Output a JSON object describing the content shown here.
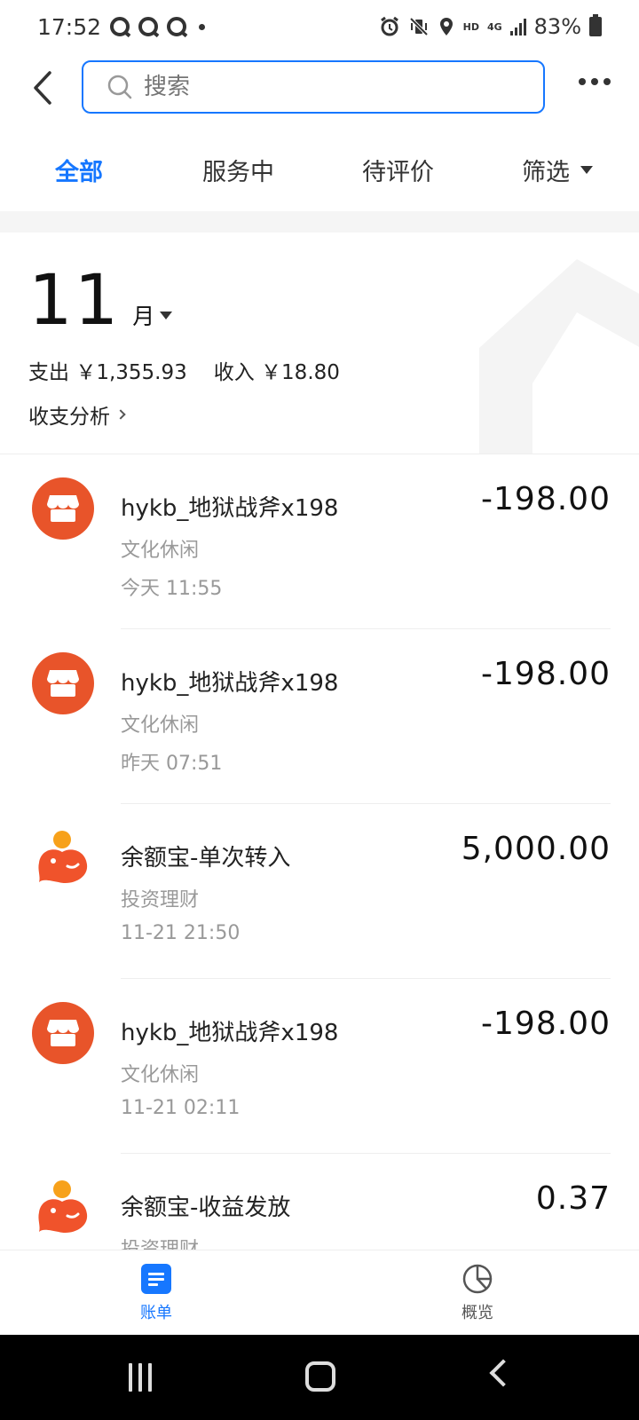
{
  "status_bar": {
    "time": "17:52",
    "battery": "83%",
    "hd_label": "HD",
    "network_label": "4G"
  },
  "header": {
    "search_placeholder": "搜索"
  },
  "tabs": [
    {
      "label": "全部",
      "active": true
    },
    {
      "label": "服务中",
      "active": false
    },
    {
      "label": "待评价",
      "active": false
    },
    {
      "label": "筛选",
      "active": false
    }
  ],
  "summary": {
    "month": "11",
    "month_unit": "月",
    "expense_label": "支出",
    "expense_value": "￥1,355.93",
    "income_label": "收入",
    "income_value": "￥18.80",
    "analysis_label": "收支分析"
  },
  "transactions": [
    {
      "icon": "shop-icon",
      "title": "hykb_地狱战斧x198",
      "category": "文化休闲",
      "time": "今天  11:55",
      "amount": "-198.00"
    },
    {
      "icon": "shop-icon",
      "title": "hykb_地狱战斧x198",
      "category": "文化休闲",
      "time": "昨天  07:51",
      "amount": "-198.00"
    },
    {
      "icon": "yuebao-icon",
      "title": "余额宝-单次转入",
      "category": "投资理财",
      "time": "11-21  21:50",
      "amount": "5,000.00"
    },
    {
      "icon": "shop-icon",
      "title": "hykb_地狱战斧x198",
      "category": "文化休闲",
      "time": "11-21  02:11",
      "amount": "-198.00"
    },
    {
      "icon": "yuebao-icon",
      "title": "余额宝-收益发放",
      "category": "投资理财",
      "time": "",
      "amount": "0.37"
    }
  ],
  "bottom_nav": [
    {
      "label": "账单",
      "active": true
    },
    {
      "label": "概览",
      "active": false
    }
  ],
  "colors": {
    "accent": "#1677ff",
    "shop_icon": "#e8542a",
    "yuebao_icon": "#f0532b"
  }
}
